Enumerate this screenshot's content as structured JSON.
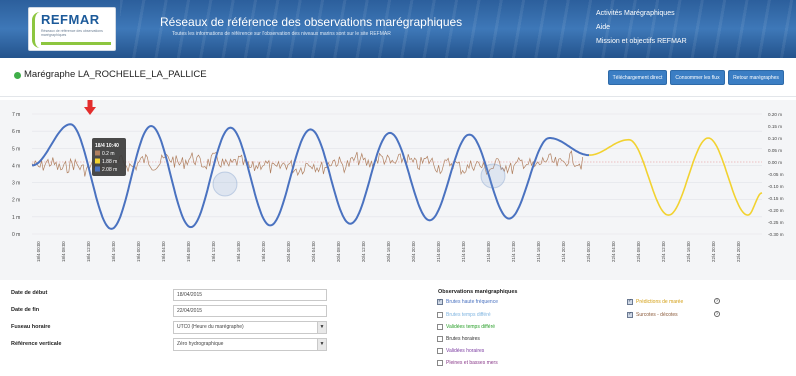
{
  "header": {
    "logo_text": "REFMAR",
    "logo_tagline": "Réseaux de référence des observations marégraphiques",
    "title": "Réseaux de référence des observations marégraphiques",
    "subtitle": "Toutes les informations de référence sur l'observation des niveaux marins sont sur le site REFMAR",
    "nav": [
      "Activités Marégraphiques",
      "Aide",
      "Mission et objectifs REFMAR"
    ]
  },
  "station": {
    "title": "Marégraphe LA_ROCHELLE_LA_PALLICE",
    "status_color": "#3fae49"
  },
  "buttons": {
    "download": "Téléchargement direct",
    "flux": "Consommer les flux",
    "return": "Retour marégraphes"
  },
  "chart_data": {
    "type": "line",
    "y_left_ticks": [
      "7 m",
      "6 m",
      "5 m",
      "4 m",
      "3 m",
      "2 m",
      "1 m",
      "0 m"
    ],
    "y_left_range": [
      0,
      7
    ],
    "y_right_ticks": [
      "0.20 m",
      "0.15 m",
      "0.10 m",
      "0.05 m",
      "0.00 m",
      "-0.05 m",
      "-0.10 m",
      "-0.15 m",
      "-0.20 m",
      "-0.25 m",
      "-0.30 m"
    ],
    "y_right_range": [
      -0.3,
      0.2
    ],
    "x_ticks": [
      "18/4 00:00",
      "18/4 04:00",
      "18/4 08:00",
      "18/4 12:00",
      "18/4 16:00",
      "18/4 20:00",
      "19/4 00:00",
      "19/4 04:00",
      "19/4 08:00",
      "19/4 12:00",
      "19/4 16:00",
      "19/4 20:00",
      "20/4 00:00",
      "20/4 04:00",
      "20/4 08:00",
      "20/4 12:00",
      "20/4 16:00",
      "20/4 20:00",
      "21/4 00:00",
      "21/4 04:00",
      "21/4 08:00",
      "21/4 12:00",
      "21/4 16:00",
      "21/4 20:00",
      "22/4 00:00",
      "22/4 04:00",
      "22/4 08:00",
      "22/4 12:00",
      "22/4 16:00",
      "22/4 20:00"
    ],
    "x_ticks_shown": [
      "18/4 00:00",
      "18/4 08:00",
      "18/4 12:00",
      "18/4 16:00",
      "19/4 00:00",
      "19/4 04:00",
      "19/4 08:00",
      "19/4 12:00",
      "19/4 16:00",
      "19/4 20:00",
      "20/4 00:00",
      "20/4 04:00",
      "20/4 08:00",
      "20/4 12:00",
      "20/4 16:00",
      "20/4 20:00",
      "21/4 00:00",
      "21/4 04:00",
      "21/4 08:00",
      "21/4 12:00",
      "21/4 16:00",
      "21/4 20:00",
      "22/4 00:00",
      "22/4 04:00",
      "22/4 08:00",
      "22/4 12:00",
      "22/4 16:00",
      "22/4 20:00",
      "22/4 20:00"
    ],
    "series": [
      {
        "name": "Brutes haute fréquence",
        "color": "#4a72c0",
        "x_hours": [
          0,
          6,
          12.4,
          18.6,
          24.8,
          31,
          37.2,
          43.5,
          49.7,
          55.9,
          62.1,
          68.3,
          74.5,
          80.8,
          87
        ],
        "values": [
          4.0,
          6.4,
          0.3,
          6.3,
          0.4,
          6.2,
          0.5,
          6.1,
          0.6,
          5.9,
          0.8,
          5.8,
          0.9,
          5.6,
          4.6
        ]
      },
      {
        "name": "Prédictions de marée",
        "color": "#f2d230",
        "x_hours": [
          87,
          93.2,
          99.4,
          105.6,
          111.8,
          114
        ],
        "values": [
          4.6,
          5.5,
          1.1,
          5.6,
          1.1,
          2.4
        ]
      },
      {
        "name": "Surcotes - décotes",
        "color": "#b08060",
        "axis": "right",
        "range_values": [
          -0.1,
          0.1
        ]
      }
    ],
    "tooltip": {
      "title": "18/4 10:40",
      "rows": [
        {
          "color": "#b08060",
          "text": "0.2 m"
        },
        {
          "color": "#f2d230",
          "text": "1.88 m"
        },
        {
          "color": "#4a72c0",
          "text": "2.08 m"
        }
      ]
    },
    "marker": {
      "color": "#e32d2d",
      "icon": "down-arrow-icon"
    },
    "grid": true,
    "zero_line_color": "#e58b8b"
  },
  "form": {
    "start_date": {
      "label": "Date de début",
      "value": "18/04/2015"
    },
    "end_date": {
      "label": "Date de fin",
      "value": "22/04/2015"
    },
    "timezone": {
      "label": "Fuseau horaire",
      "value": "UTC0 (Heure du marégraphe)"
    },
    "reference": {
      "label": "Référence verticale",
      "value": "Zéro hydrographique"
    }
  },
  "observations": {
    "title": "Observations marégraphiques",
    "items": [
      {
        "label": "Brutes haute fréquence",
        "checked": true,
        "color": "#4a72c0"
      },
      {
        "label": "Brutes temps différé",
        "checked": false,
        "color": "#7fb4e0"
      },
      {
        "label": "Validées temps différé",
        "checked": false,
        "color": "#2aa02a"
      },
      {
        "label": "Brutes horaires",
        "checked": false,
        "color": "#333333"
      },
      {
        "label": "Validées horaires",
        "checked": false,
        "color": "#7a3aa0"
      },
      {
        "label": "Pleines et basses mers",
        "checked": false,
        "color": "#8a3a8a"
      },
      {
        "label": "Prédictions de marée",
        "checked": true,
        "color": "#d4a017"
      },
      {
        "label": "Surcotes - décotes",
        "checked": true,
        "color": "#8a5a3a"
      }
    ]
  }
}
